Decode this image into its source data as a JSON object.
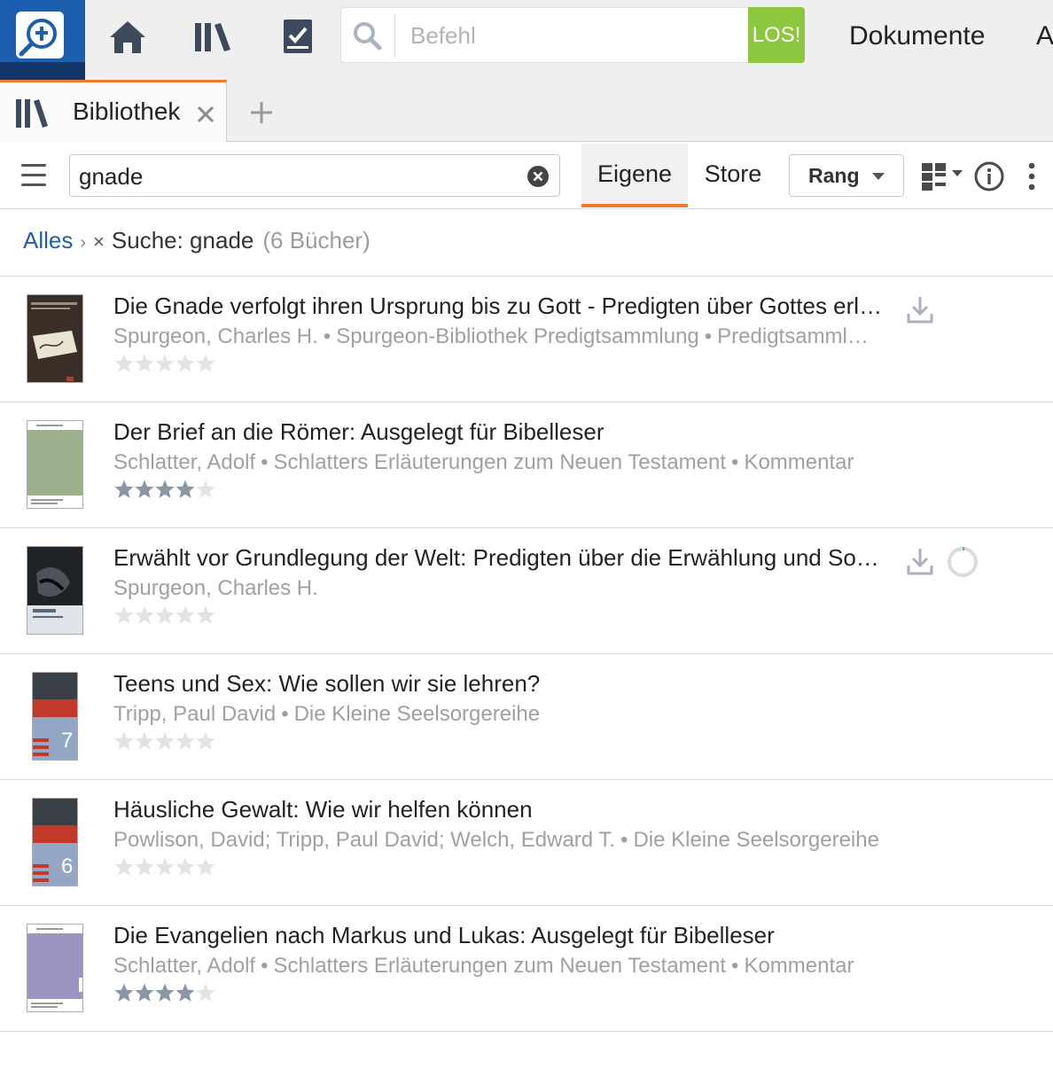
{
  "toolbar": {
    "command_placeholder": "Befehl",
    "go_label": "LOS!",
    "documents_label": "Dokumente",
    "next_menu_partial": "A"
  },
  "tabs": [
    {
      "label": "Bibliothek",
      "icon": "library-icon",
      "active": true
    }
  ],
  "filter": {
    "query": "gnade",
    "scope_own": "Eigene",
    "scope_store": "Store",
    "sort_label": "Rang"
  },
  "breadcrumb": {
    "root": "Alles",
    "current": "Suche: gnade",
    "count": "(6 Bücher)"
  },
  "colors": {
    "accent_orange": "#f07c2b",
    "go_green": "#8dc63f",
    "logo_blue": "#1b5fae",
    "link_blue": "#1f5ea8",
    "star_filled": "#8a96a4",
    "star_empty": "#e3e3e3"
  },
  "books": [
    {
      "title": "Die Gnade verfolgt ihren Ursprung bis zu Gott - Predigten über Gottes erl…",
      "author": "Spurgeon, Charles H.",
      "series": "Spurgeon-Bibliothek Predigtsammlung",
      "type": "Predigtsamml…",
      "rating": 0,
      "download": true,
      "progress": false,
      "cover_text": ""
    },
    {
      "title": "Der Brief an die Römer: Ausgelegt für Bibelleser",
      "author": "Schlatter, Adolf",
      "series": "Schlatters Erläuterungen zum Neuen Testament",
      "type": "Kommentar",
      "rating": 4,
      "download": false,
      "progress": false,
      "cover_text": "Der Brief an die Römer"
    },
    {
      "title": "Erwählt vor Grundlegung der Welt: Predigten über die Erwählung und So…",
      "author": "Spurgeon, Charles H.",
      "series": "",
      "type": "",
      "rating": 0,
      "download": true,
      "progress": true,
      "cover_text": "Erwählt"
    },
    {
      "title": "Teens und Sex: Wie sollen wir sie lehren?",
      "author": "Tripp, Paul David",
      "series": "Die Kleine Seelsorgereihe",
      "type": "",
      "rating": 0,
      "download": false,
      "progress": false,
      "cover_text": "7"
    },
    {
      "title": "Häusliche Gewalt: Wie wir helfen können",
      "author": "Powlison, David; Tripp, Paul David; Welch, Edward T.",
      "series": "Die Kleine Seelsorgereihe",
      "type": "",
      "rating": 0,
      "download": false,
      "progress": false,
      "cover_text": "6"
    },
    {
      "title": "Die Evangelien nach Markus und Lukas: Ausgelegt für Bibelleser",
      "author": "Schlatter, Adolf",
      "series": "Schlatters Erläuterungen zum Neuen Testament",
      "type": "Kommentar",
      "rating": 4,
      "download": false,
      "progress": false,
      "cover_text": "Die Evangelien nach Markus und Lukas"
    }
  ]
}
